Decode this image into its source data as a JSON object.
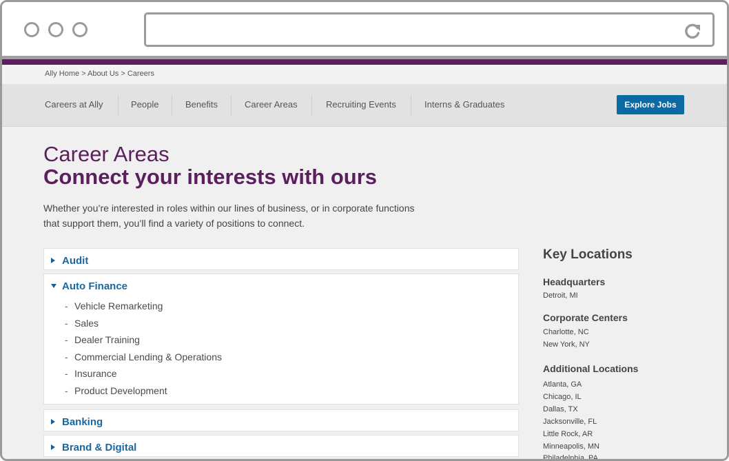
{
  "browser": {
    "address_value": "",
    "reload_icon": "reload-icon"
  },
  "breadcrumb": "Ally Home > About Us > Careers",
  "subnav": {
    "items": [
      "Careers at  Ally",
      "People",
      "Benefits",
      "Career Areas",
      "Recruiting Events",
      "Interns & Graduates"
    ],
    "cta": "Explore Jobs"
  },
  "hero": {
    "eyebrow": "Career Areas",
    "headline": "Connect your interests with ours",
    "intro_line1": "Whether you’re interested in roles within our lines of business, or in corporate functions",
    "intro_line2": "that support them, you’ll find a variety of positions to connect."
  },
  "accordion": [
    {
      "title": "Audit",
      "expanded": false
    },
    {
      "title": "Auto Finance",
      "expanded": true,
      "items": [
        "Vehicle Remarketing",
        "Sales",
        "Dealer Training",
        "Commercial Lending & Operations",
        "Insurance",
        "Product Development"
      ]
    },
    {
      "title": "Banking",
      "expanded": false
    },
    {
      "title": "Brand & Digital",
      "expanded": false
    }
  ],
  "locations": {
    "title": "Key Locations",
    "headquarters_label": "Headquarters",
    "headquarters": [
      "Detroit, MI"
    ],
    "corporate_label": "Corporate Centers",
    "corporate": [
      "Charlotte, NC",
      "New York, NY"
    ],
    "additional_label": "Additional Locations",
    "additional": [
      "Atlanta, GA",
      "Chicago, IL",
      "Dallas, TX",
      "Jacksonville, FL",
      "Little Rock, AR",
      "Minneapolis, MN",
      "Philadelphia, PA"
    ]
  },
  "colors": {
    "brand_purple": "#5c1f5d",
    "link_blue": "#1a68a0",
    "button_blue": "#0b6aa2"
  }
}
